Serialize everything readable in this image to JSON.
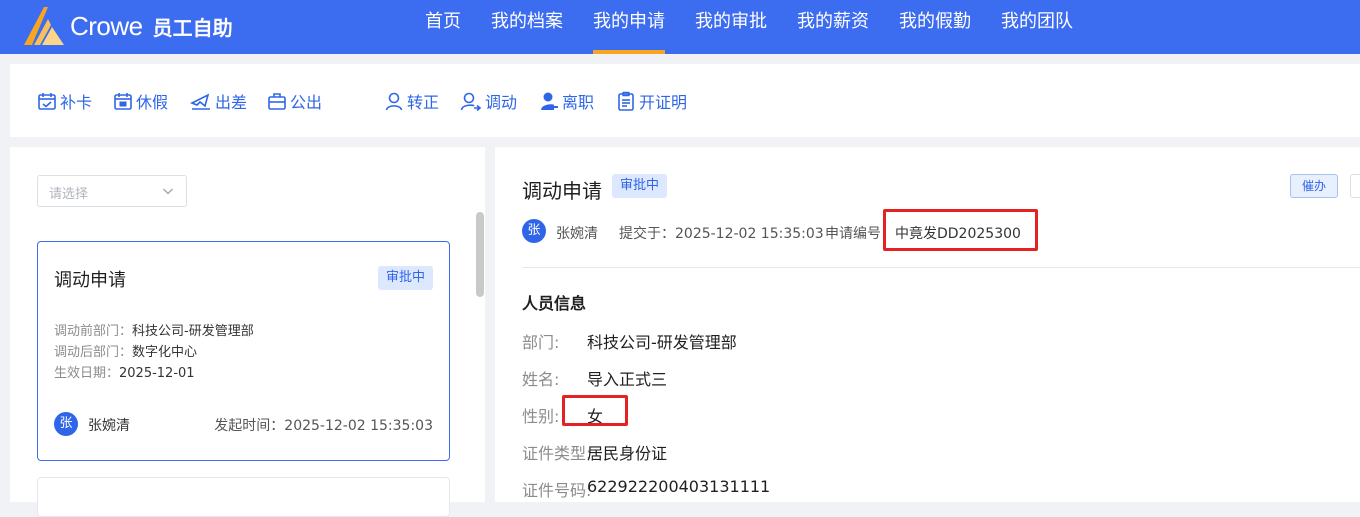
{
  "header": {
    "brand": "Crowe",
    "product": "员工自助",
    "nav": [
      "首页",
      "我的档案",
      "我的申请",
      "我的审批",
      "我的薪资",
      "我的假勤",
      "我的团队"
    ],
    "active_nav": "我的申请"
  },
  "toolbar": {
    "items": [
      {
        "label": "补卡",
        "icon": "calendar-check-icon"
      },
      {
        "label": "休假",
        "icon": "calendar-leave-icon"
      },
      {
        "label": "出差",
        "icon": "plane-icon"
      },
      {
        "label": "公出",
        "icon": "briefcase-icon"
      },
      {
        "label": "转正",
        "icon": "user-icon"
      },
      {
        "label": "调动",
        "icon": "user-transfer-icon"
      },
      {
        "label": "离职",
        "icon": "user-leave-icon"
      },
      {
        "label": "开证明",
        "icon": "clipboard-icon"
      }
    ]
  },
  "filter": {
    "placeholder": "请选择"
  },
  "card": {
    "title": "调动申请",
    "status": "审批中",
    "fields": [
      {
        "label": "调动前部门：",
        "value": "科技公司-研发管理部"
      },
      {
        "label": "调动后部门：",
        "value": "数字化中心"
      },
      {
        "label": "生效日期：",
        "value": "2025-12-01"
      }
    ],
    "avatar": "张",
    "user": "张婉清",
    "time_label": "发起时间：",
    "time": "2025-12-02 15:35:03"
  },
  "detail": {
    "title": "调动申请",
    "status": "审批中",
    "urge_button": "催办",
    "avatar": "张",
    "user": "张婉清",
    "submitted_label": "提交于：",
    "submitted": "2025-12-02 15:35:03",
    "app_no_label": "申请编号",
    "app_no": "中竟发DD2025300",
    "section": "人员信息",
    "fields": [
      {
        "label": "部门:",
        "value": "科技公司-研发管理部"
      },
      {
        "label": "姓名:",
        "value": "导入正式三"
      },
      {
        "label": "性别:",
        "value": "女"
      },
      {
        "label": "证件类型:",
        "value": "居民身份证"
      },
      {
        "label": "证件号码:",
        "value": "622922200403131111"
      }
    ]
  },
  "colors": {
    "primary": "#3c6cf0",
    "accent": "#f6a623",
    "highlight": "#e42222"
  }
}
